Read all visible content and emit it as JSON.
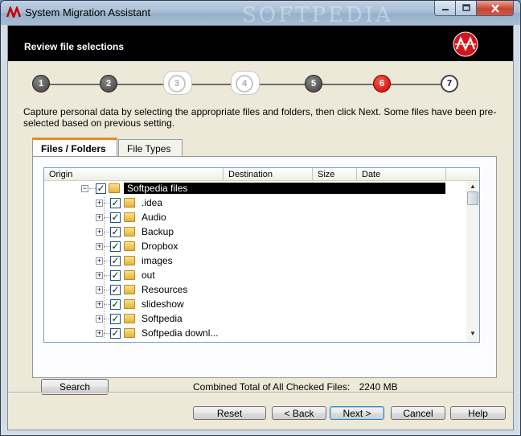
{
  "window": {
    "title": "System Migration Assistant",
    "watermark": "SOFTPEDIA",
    "min_icon": "minimize-icon",
    "max_icon": "maximize-icon",
    "close_icon": "close-icon"
  },
  "header": {
    "title": "Review file selections",
    "logo_icon": "sma-logo-icon"
  },
  "wizard_steps": [
    {
      "label": "1",
      "state": "done"
    },
    {
      "label": "2",
      "state": "done"
    },
    {
      "label": "3",
      "state": "skipped"
    },
    {
      "label": "4",
      "state": "skipped"
    },
    {
      "label": "5",
      "state": "done"
    },
    {
      "label": "6",
      "state": "current"
    },
    {
      "label": "7",
      "state": "pending"
    }
  ],
  "description": "Capture personal data by selecting the appropriate files and folders, then click Next. Some files have been pre-selected based on previous setting.",
  "tabs": [
    {
      "label": "Files / Folders",
      "active": true
    },
    {
      "label": "File Types",
      "active": false
    }
  ],
  "tree": {
    "columns": [
      "Origin",
      "Destination",
      "Size",
      "Date"
    ],
    "root": {
      "label": "Softpedia files",
      "checked": true,
      "expander": "−"
    },
    "children": [
      {
        "label": ".idea",
        "checked": true,
        "expander": "+"
      },
      {
        "label": "Audio",
        "checked": true,
        "expander": "+"
      },
      {
        "label": "Backup",
        "checked": true,
        "expander": "+"
      },
      {
        "label": "Dropbox",
        "checked": true,
        "expander": "+"
      },
      {
        "label": "images",
        "checked": true,
        "expander": "+"
      },
      {
        "label": "out",
        "checked": true,
        "expander": "+"
      },
      {
        "label": "Resources",
        "checked": true,
        "expander": "+"
      },
      {
        "label": "slideshow",
        "checked": true,
        "expander": "+"
      },
      {
        "label": "Softpedia",
        "checked": true,
        "expander": "+"
      },
      {
        "label": "Softpedia downl...",
        "checked": true,
        "expander": "+"
      }
    ],
    "check_glyph": "✓",
    "scroll_up_glyph": "▲",
    "scroll_down_glyph": "▼"
  },
  "search_button": "Search",
  "total": {
    "label": "Combined Total of All Checked Files:",
    "value": "2240 MB"
  },
  "buttons": {
    "reset": "Reset",
    "back": "< Back",
    "next": "Next >",
    "cancel": "Cancel",
    "help": "Help"
  },
  "colors": {
    "current_step": "#c40000",
    "tab_accent": "#e68b2c",
    "selection": "#000000"
  }
}
